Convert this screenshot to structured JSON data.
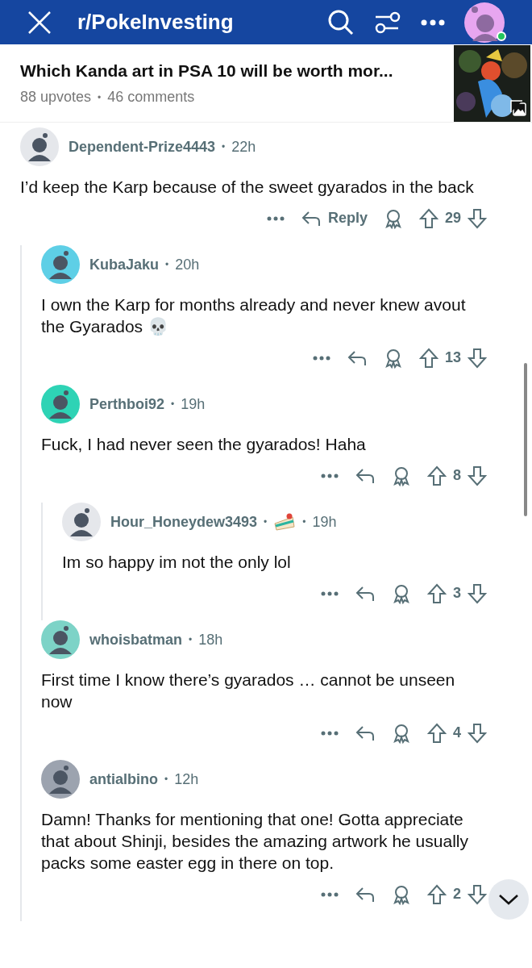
{
  "header": {
    "title": "r/PokeInvesting"
  },
  "post": {
    "title": "Which Kanda art in PSA 10 will be worth mor...",
    "upvotes": "88 upvotes",
    "dot": "•",
    "comments": "46 comments"
  },
  "comments": [
    {
      "author": "Dependent-Prize4443",
      "dots": [
        "•"
      ],
      "time": "22h",
      "color": "#e5e7eb",
      "body": "I’d keep the Karp because of the sweet gyarados in the back",
      "reply": "Reply",
      "votes": "29",
      "children": [
        {
          "author": "KubaJaku",
          "dots": [
            "•"
          ],
          "time": "20h",
          "color": "#5ecfe6",
          "body": "I own the Karp for months already and never knew avout the Gyarados 💀",
          "votes": "13"
        },
        {
          "author": "Perthboi92",
          "dots": [
            "•"
          ],
          "time": "19h",
          "color": "#2ed3b5",
          "body": "Fuck, I had never seen the gyarados! Haha",
          "votes": "8",
          "children": [
            {
              "author": "Hour_Honeydew3493",
              "dots": [
                "•",
                "•"
              ],
              "time": "19h",
              "color": "#e5e7eb",
              "flair": true,
              "body": "Im so happy im not the only lol",
              "votes": "3"
            }
          ]
        },
        {
          "author": "whoisbatman",
          "dots": [
            "•"
          ],
          "time": "18h",
          "color": "#7dd3c7",
          "body": "First time I know there’s gyarados … cannot be unseen now",
          "votes": "4"
        },
        {
          "author": "antialbino",
          "dots": [
            "•"
          ],
          "time": "12h",
          "color": "#9ca3af",
          "body": "Damn! Thanks for mentioning that one! Gotta appreciate that about Shinji, besides the amazing artwork he usually packs some easter egg in there on top.",
          "votes": "2"
        }
      ]
    }
  ]
}
